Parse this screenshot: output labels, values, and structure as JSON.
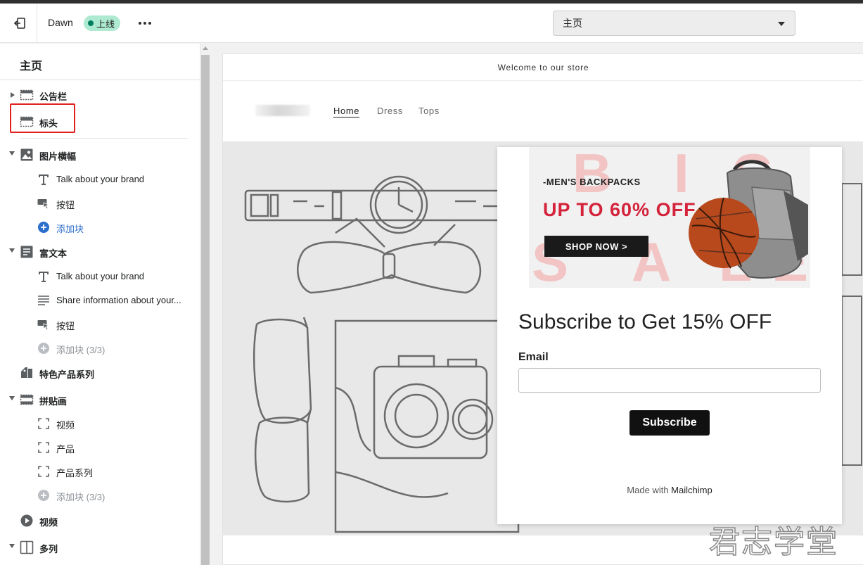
{
  "topbar": {
    "theme_name": "Dawn",
    "status_badge": "上线",
    "page_selector": "主页",
    "colors": {
      "badge_bg": "#aee9d1",
      "badge_dot": "#007f5f"
    }
  },
  "sidebar": {
    "title": "主页",
    "items": [
      {
        "label": "公告栏"
      },
      {
        "label": "标头"
      },
      {
        "label": "图片横幅"
      },
      {
        "label": "Talk about your brand"
      },
      {
        "label": "按钮"
      },
      {
        "label": "添加块"
      },
      {
        "label": "富文本"
      },
      {
        "label": "Talk about your brand"
      },
      {
        "label": "Share information about your..."
      },
      {
        "label": "按钮"
      },
      {
        "label": "添加块 (3/3)"
      },
      {
        "label": "特色产品系列"
      },
      {
        "label": "拼贴画"
      },
      {
        "label": "视频"
      },
      {
        "label": "产品"
      },
      {
        "label": "产品系列"
      },
      {
        "label": "添加块 (3/3)"
      },
      {
        "label": "视频"
      },
      {
        "label": "多列"
      }
    ]
  },
  "preview": {
    "announcement": "Welcome to our store",
    "nav": [
      "Home",
      "Dress",
      "Tops"
    ],
    "popup": {
      "promo_big_letters": [
        "B",
        "I",
        "G",
        "S",
        "A",
        "L",
        "E"
      ],
      "promo_subtitle": "-MEN'S BACKPACKS",
      "promo_headline": "UP TO 60% OFF",
      "promo_button": "SHOP NOW >",
      "headline": "Subscribe to Get 15% OFF",
      "email_label": "Email",
      "email_value": "",
      "subscribe_button": "Subscribe",
      "made_with": "Made with",
      "made_with_brand": "Mailchimp"
    }
  },
  "watermark": "君志学堂"
}
